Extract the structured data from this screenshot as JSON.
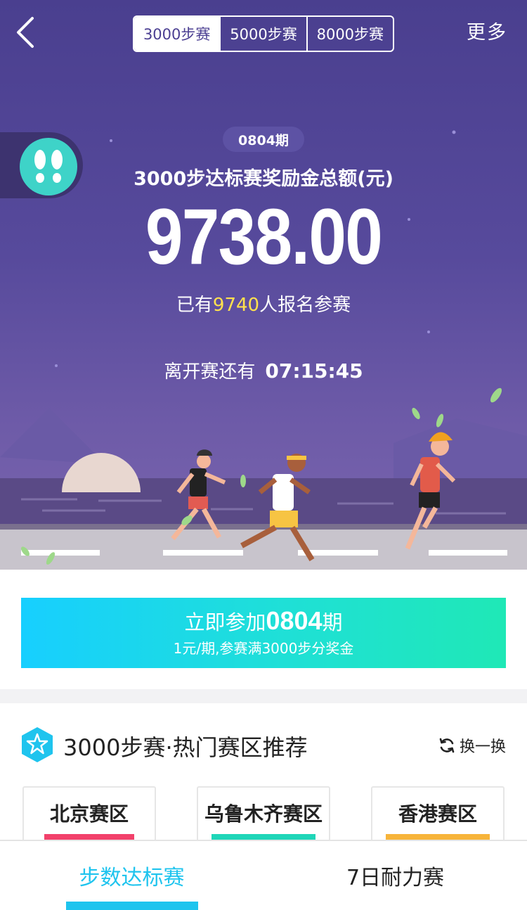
{
  "header": {
    "tabs": [
      {
        "label": "3000步赛",
        "active": true
      },
      {
        "label": "5000步赛",
        "active": false
      },
      {
        "label": "8000步赛",
        "active": false
      }
    ],
    "more_label": "更多"
  },
  "hero": {
    "period": "0804期",
    "pool_title": "3000步达标赛奖励金总额(元)",
    "pool_amount": "9738.00",
    "entrants_prefix": "已有",
    "entrants_count": "9740",
    "entrants_suffix": "人报名参赛",
    "countdown_label": "离开赛还有",
    "countdown_time": "07:15:45"
  },
  "join": {
    "label_prefix": "立即参加",
    "period_number": "0804",
    "label_suffix": "期",
    "subtitle": "1元/期,参赛满3000步分奖金"
  },
  "hot": {
    "title": "3000步赛·热门赛区推荐",
    "refresh_label": "换一换",
    "zones": [
      {
        "name": "北京赛区",
        "tag_color": "#f2416b"
      },
      {
        "name": "乌鲁木齐赛区",
        "tag_color": "#1fd6b8"
      },
      {
        "name": "香港赛区",
        "tag_color": "#f7b43a"
      }
    ]
  },
  "tabbar": {
    "tabs": [
      {
        "label": "步数达标赛",
        "active": true
      },
      {
        "label": "7日耐力赛",
        "active": false
      }
    ]
  },
  "colors": {
    "hero_bg": "#574a9c",
    "accent_cyan": "#1fc4ee",
    "highlight_yellow": "#ffe14d",
    "badge_teal": "#3ed3c8"
  },
  "icons": [
    "back-chevron-icon",
    "footprints-icon",
    "star-hexagon-icon",
    "refresh-icon"
  ]
}
